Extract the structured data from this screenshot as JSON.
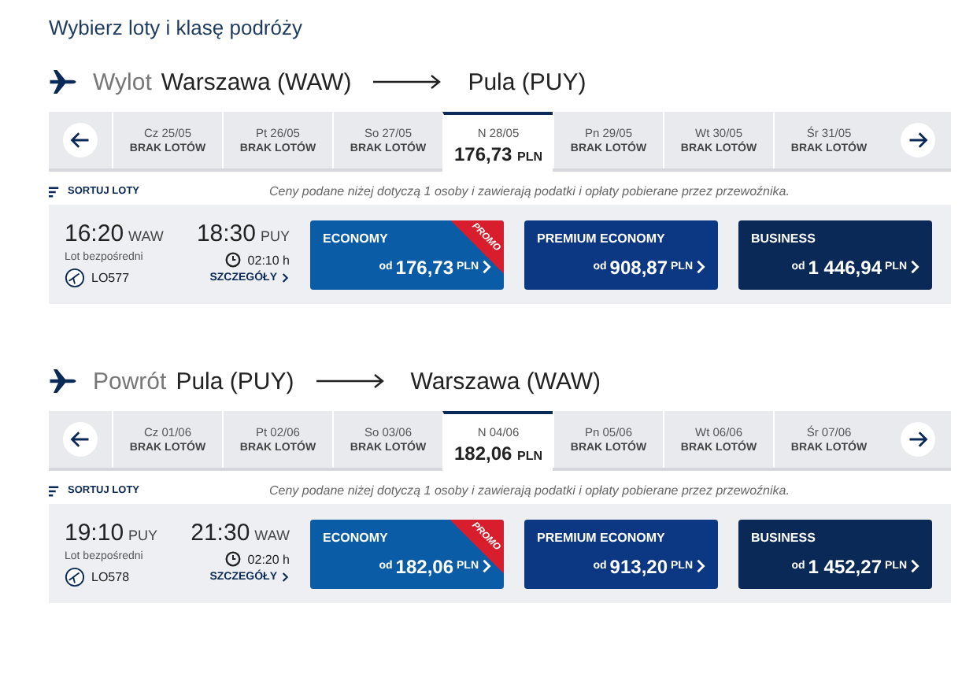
{
  "title": "Wybierz loty i klasę podróży",
  "legs": [
    {
      "direction": "Wylot",
      "from": "Warszawa (WAW)",
      "to": "Pula (PUY)",
      "dates": [
        {
          "label": "Cz 25/05",
          "status": "BRAK LOTÓW",
          "selected": false
        },
        {
          "label": "Pt 26/05",
          "status": "BRAK LOTÓW",
          "selected": false
        },
        {
          "label": "So 27/05",
          "status": "BRAK LOTÓW",
          "selected": false
        },
        {
          "label": "N 28/05",
          "price": "176,73",
          "currency": "PLN",
          "selected": true
        },
        {
          "label": "Pn 29/05",
          "status": "BRAK LOTÓW",
          "selected": false
        },
        {
          "label": "Wt 30/05",
          "status": "BRAK LOTÓW",
          "selected": false
        },
        {
          "label": "Śr 31/05",
          "status": "BRAK LOTÓW",
          "selected": false
        }
      ],
      "sort_label": "SORTUJ LOTY",
      "note": "Ceny podane niżej dotyczą 1 osoby i zawierają podatki i opłaty pobierane przez przewoźnika.",
      "flight": {
        "dep_time": "16:20",
        "dep_code": "WAW",
        "arr_time": "18:30",
        "arr_code": "PUY",
        "type": "Lot bezpośredni",
        "duration": "02:10 h",
        "number": "LO577",
        "details": "SZCZEGÓŁY"
      },
      "fares": [
        {
          "kind": "economy",
          "class": "ECONOMY",
          "prefix": "od",
          "amount": "176,73",
          "currency": "PLN",
          "badge": "PROMO"
        },
        {
          "kind": "premium",
          "class": "PREMIUM ECONOMY",
          "prefix": "od",
          "amount": "908,87",
          "currency": "PLN"
        },
        {
          "kind": "business",
          "class": "BUSINESS",
          "prefix": "od",
          "amount": "1 446,94",
          "currency": "PLN"
        }
      ]
    },
    {
      "direction": "Powrót",
      "from": "Pula (PUY)",
      "to": "Warszawa (WAW)",
      "dates": [
        {
          "label": "Cz 01/06",
          "status": "BRAK LOTÓW",
          "selected": false
        },
        {
          "label": "Pt 02/06",
          "status": "BRAK LOTÓW",
          "selected": false
        },
        {
          "label": "So 03/06",
          "status": "BRAK LOTÓW",
          "selected": false
        },
        {
          "label": "N 04/06",
          "price": "182,06",
          "currency": "PLN",
          "selected": true
        },
        {
          "label": "Pn 05/06",
          "status": "BRAK LOTÓW",
          "selected": false
        },
        {
          "label": "Wt 06/06",
          "status": "BRAK LOTÓW",
          "selected": false
        },
        {
          "label": "Śr 07/06",
          "status": "BRAK LOTÓW",
          "selected": false
        }
      ],
      "sort_label": "SORTUJ LOTY",
      "note": "Ceny podane niżej dotyczą 1 osoby i zawierają podatki i opłaty pobierane przez przewoźnika.",
      "flight": {
        "dep_time": "19:10",
        "dep_code": "PUY",
        "arr_time": "21:30",
        "arr_code": "WAW",
        "type": "Lot bezpośredni",
        "duration": "02:20 h",
        "number": "LO578",
        "details": "SZCZEGÓŁY"
      },
      "fares": [
        {
          "kind": "economy",
          "class": "ECONOMY",
          "prefix": "od",
          "amount": "182,06",
          "currency": "PLN",
          "badge": "PROMO"
        },
        {
          "kind": "premium",
          "class": "PREMIUM ECONOMY",
          "prefix": "od",
          "amount": "913,20",
          "currency": "PLN"
        },
        {
          "kind": "business",
          "class": "BUSINESS",
          "prefix": "od",
          "amount": "1 452,27",
          "currency": "PLN"
        }
      ]
    }
  ]
}
